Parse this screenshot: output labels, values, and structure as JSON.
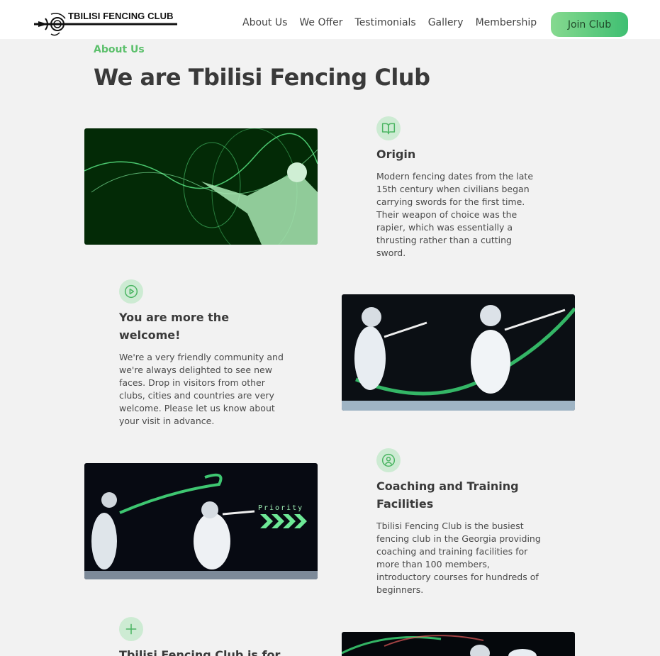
{
  "brand": {
    "name": "TBILISI FENCING CLUB"
  },
  "nav": {
    "items": [
      "About Us",
      "We Offer",
      "Testimonials",
      "Gallery",
      "Membership"
    ],
    "join_label": "Join Club"
  },
  "about": {
    "kicker": "About Us",
    "title": "We are Tbilisi Fencing Club",
    "features": [
      {
        "icon": "book-icon",
        "title": "Origin",
        "text": "Modern fencing dates from the late 15th century when civilians began carrying swords for the first time. Their weapon of choice was the rapier, which was essentially a thrusting rather than a cutting sword."
      },
      {
        "icon": "play-circle-icon",
        "title": "You are more the welcome!",
        "text": "We're a very friendly community and we're always delighted to see new faces. Drop in visitors from other clubs, cities and countries are very welcome. Please let us know about your visit in advance."
      },
      {
        "icon": "user-circle-icon",
        "title": "Coaching and Training Facilities",
        "text": "Tbilisi Fencing Club is the busiest fencing club in the Georgia providing coaching and training facilities for more than 100 members, introductory courses for hundreds of beginners."
      },
      {
        "icon": "plus-icon",
        "title": "Tbilisi Fencing Club is for",
        "text": ""
      }
    ],
    "photo_overlay_text": "Priority"
  },
  "colors": {
    "accent": "#5cc06c",
    "button_start": "#86d98f",
    "button_end": "#3fbf72",
    "background": "#f2f2f2"
  }
}
